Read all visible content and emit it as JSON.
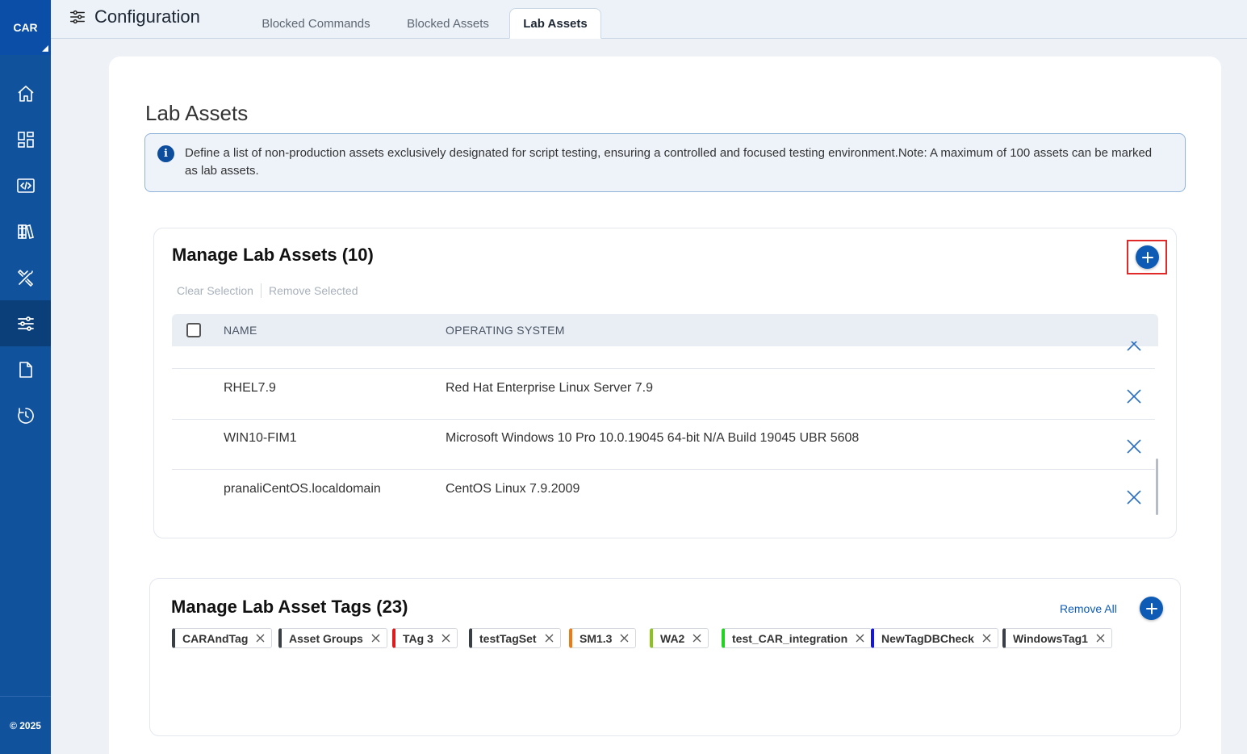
{
  "app": {
    "brand": "CAR",
    "copyright": "© 2025"
  },
  "sidebar": {
    "items": [
      {
        "icon": "home-icon",
        "label": "home"
      },
      {
        "icon": "dashboard-icon",
        "label": "dashboard"
      },
      {
        "icon": "code-icon",
        "label": "scripts"
      },
      {
        "icon": "library-icon",
        "label": "library"
      },
      {
        "icon": "tools-icon",
        "label": "tools"
      },
      {
        "icon": "settings-sliders-icon",
        "label": "configuration",
        "active": true
      },
      {
        "icon": "document-icon",
        "label": "reports"
      },
      {
        "icon": "history-icon",
        "label": "history"
      }
    ]
  },
  "header": {
    "title": "Configuration",
    "tabs": [
      {
        "label": "Blocked Commands"
      },
      {
        "label": "Blocked Assets"
      },
      {
        "label": "Lab Assets",
        "active": true
      }
    ]
  },
  "page": {
    "title": "Lab Assets",
    "info": "Define a list of non-production assets exclusively designated for script testing, ensuring a controlled and focused testing environment.Note: A maximum of 100 assets can be marked as lab assets."
  },
  "assets": {
    "title": "Manage Lab Assets (10)",
    "clear_selection": "Clear Selection",
    "remove_selected": "Remove Selected",
    "columns": {
      "name": "NAME",
      "os": "OPERATING SYSTEM"
    },
    "rows": [
      {
        "name": "RHEL7.9",
        "os": "Red Hat Enterprise Linux Server 7.9"
      },
      {
        "name": "WIN10-FIM1",
        "os": "Microsoft Windows 10 Pro 10.0.19045 64-bit N/A Build 19045 UBR 5608"
      },
      {
        "name": "pranaliCentOS.localdomain",
        "os": "CentOS Linux 7.9.2009"
      }
    ]
  },
  "tags": {
    "title": "Manage Lab Asset Tags (23)",
    "remove_all": "Remove All",
    "items": [
      {
        "label": "CARAndTag",
        "color": "#3a3f47"
      },
      {
        "label": "Asset Groups",
        "color": "#3a3f47"
      },
      {
        "label": "TAg 3",
        "color": "#e01b1b"
      },
      {
        "label": "testTagSet",
        "color": "#3a3f47"
      },
      {
        "label": "SM1.3",
        "color": "#f07a12"
      },
      {
        "label": "WA2",
        "color": "#8cc21e"
      },
      {
        "label": "test_CAR_integration",
        "color": "#22d422"
      },
      {
        "label": "NewTagDBCheck",
        "color": "#1414e6"
      },
      {
        "label": "WindowsTag1",
        "color": "#3a3f47"
      }
    ]
  },
  "colors": {
    "sidebar": "#10539c",
    "accent": "#0d5bb5",
    "highlight": "#e02a2a"
  }
}
